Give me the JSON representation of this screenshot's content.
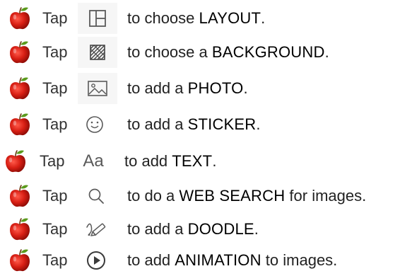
{
  "rows": [
    {
      "tap": "Tap",
      "icon": "layout-icon",
      "pre": "to choose ",
      "kw": "LAYOUT",
      "post": "."
    },
    {
      "tap": "Tap",
      "icon": "background-icon",
      "pre": "to choose a ",
      "kw": "BACKGROUND",
      "post": "."
    },
    {
      "tap": "Tap",
      "icon": "photo-icon",
      "pre": "to add a ",
      "kw": "PHOTO",
      "post": "."
    },
    {
      "tap": "Tap",
      "icon": "sticker-icon",
      "pre": "to add a ",
      "kw": "STICKER",
      "post": "."
    },
    {
      "tap": "Tap",
      "icon": "text-icon",
      "pre": "to add ",
      "kw": "TEXT",
      "post": ".",
      "icon_label": "Aa"
    },
    {
      "tap": "Tap",
      "icon": "search-icon",
      "pre": "to do a ",
      "kw": "WEB SEARCH",
      "post": " for images."
    },
    {
      "tap": "Tap",
      "icon": "doodle-icon",
      "pre": "to add a ",
      "kw": "DOODLE",
      "post": "."
    },
    {
      "tap": "Tap",
      "icon": "animation-icon",
      "pre": "to add ",
      "kw": "ANIMATION",
      "post": " to images."
    }
  ],
  "colors": {
    "apple": "#d81f14",
    "leaf": "#5a9a1c",
    "icon": "#5a5a5a"
  }
}
